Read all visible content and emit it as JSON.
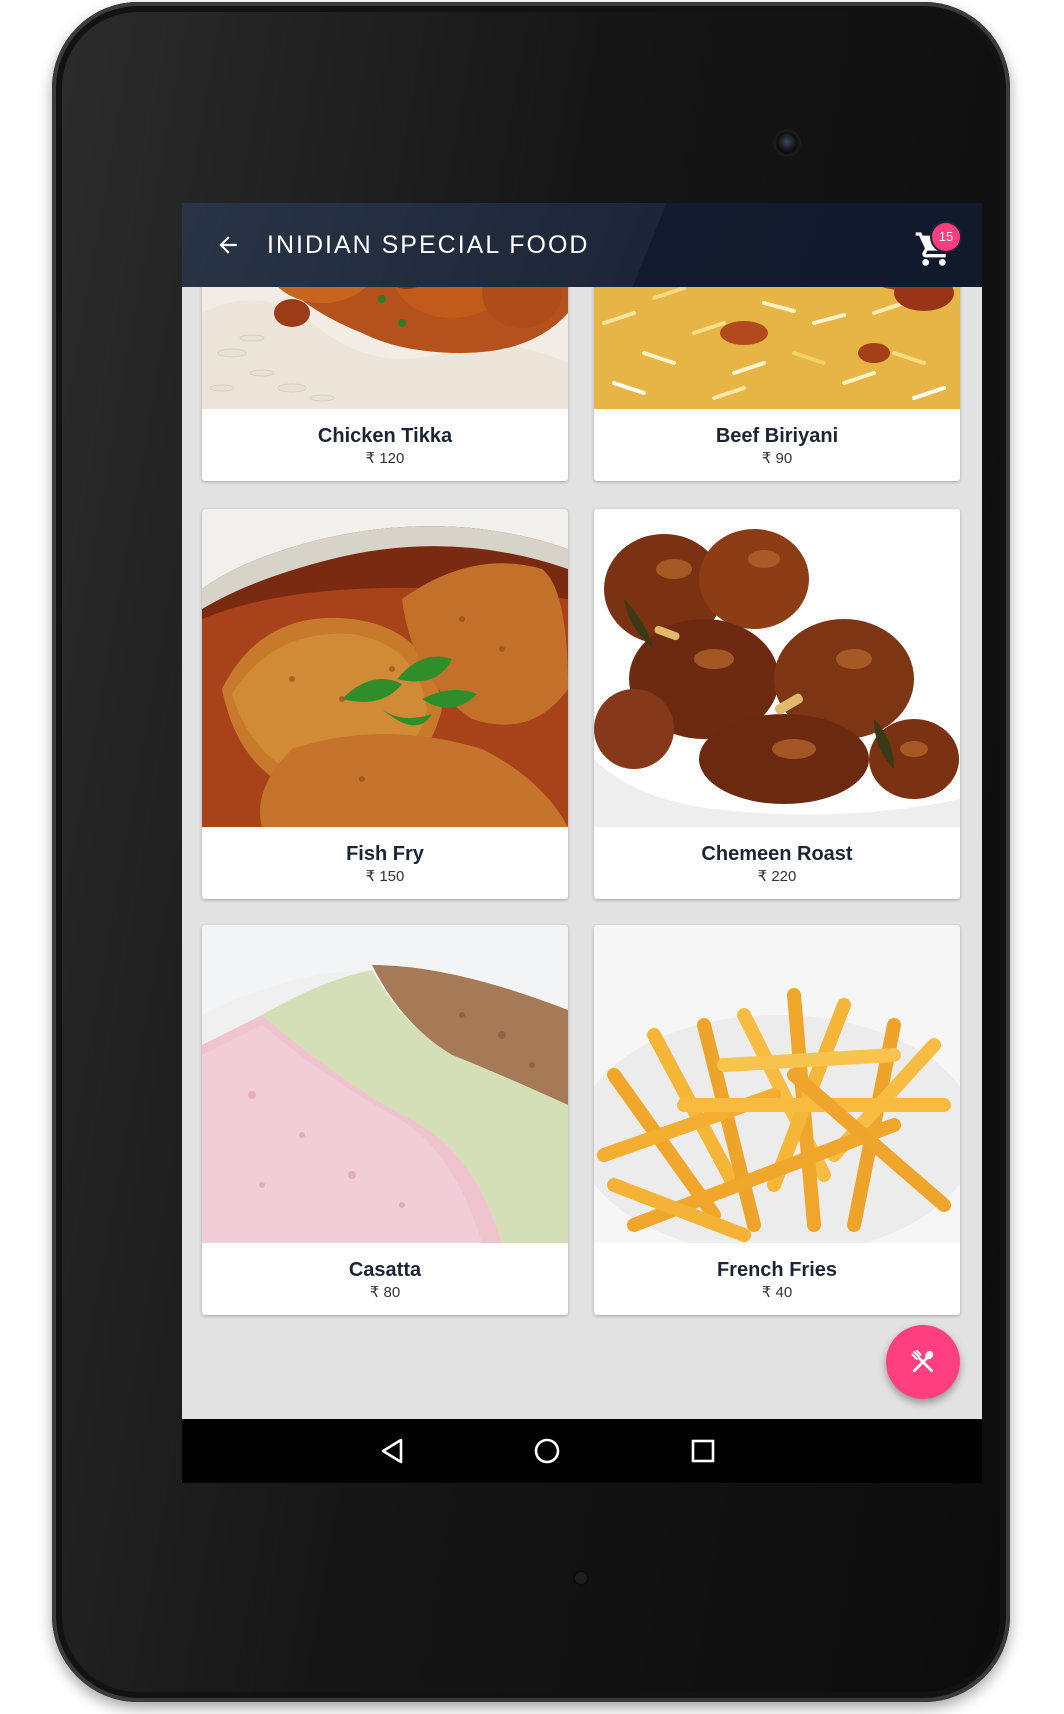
{
  "app": {
    "title": "INIDIAN SPECIAL FOOD",
    "cart_count": "15",
    "accent": "#ff3f80",
    "appbar_color": "#1c2638"
  },
  "currency_symbol": "₹",
  "foods": [
    {
      "name": "Chicken Tikka",
      "price": "₹ 120"
    },
    {
      "name": "Beef Biriyani",
      "price": "₹ 90"
    },
    {
      "name": "Fish Fry",
      "price": "₹ 150"
    },
    {
      "name": "Chemeen Roast",
      "price": "₹ 220"
    },
    {
      "name": "Casatta",
      "price": "₹ 80"
    },
    {
      "name": "French Fries",
      "price": "₹ 40"
    }
  ],
  "icons": {
    "back": "arrow-left-icon",
    "cart": "shopping-cart-icon",
    "fab": "cutlery-icon",
    "nav_back": "triangle-back-icon",
    "nav_home": "circle-home-icon",
    "nav_recents": "square-recents-icon"
  }
}
